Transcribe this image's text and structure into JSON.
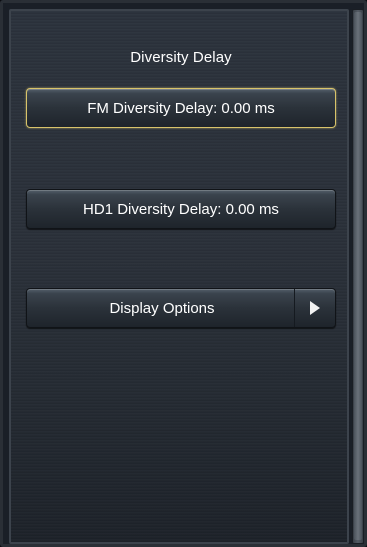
{
  "screen": {
    "title": "Diversity Delay"
  },
  "menu": {
    "items": [
      {
        "label": "FM Diversity Delay: 0.00 ms",
        "selected": true
      },
      {
        "label": "HD1 Diversity Delay: 0.00 ms",
        "selected": false
      },
      {
        "label": "Display Options",
        "has_submenu": true,
        "icon": "chevron-right-icon"
      }
    ]
  },
  "colors": {
    "selected_border": "#d8c36a",
    "text": "#ffffff",
    "panel_bg": "#2a3039"
  }
}
